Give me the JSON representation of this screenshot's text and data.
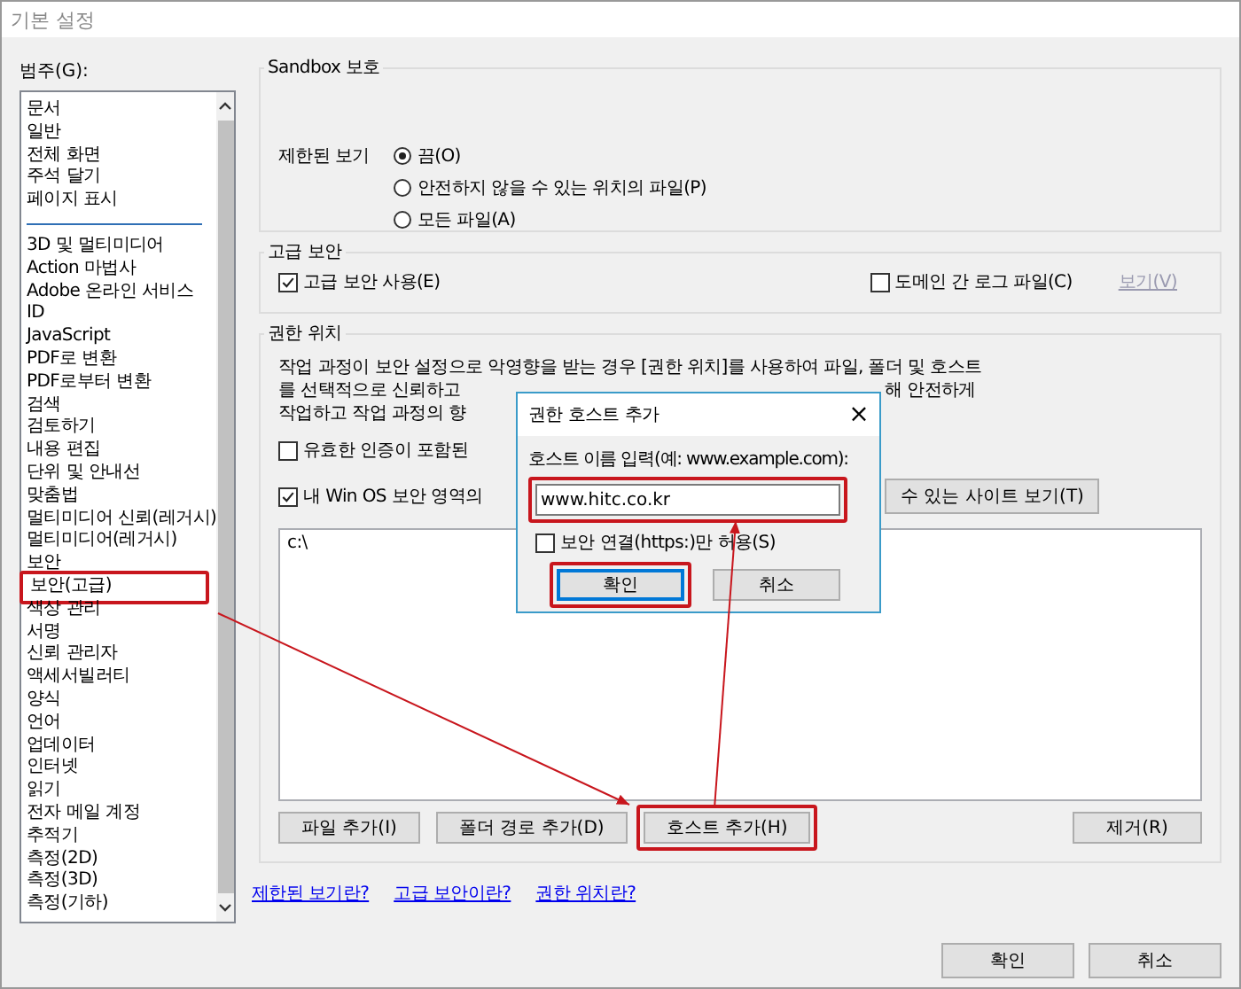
{
  "window": {
    "title": "기본 설정"
  },
  "categories": {
    "label": "범주(G):",
    "groups": [
      {
        "items": [
          {
            "label": "문서",
            "selected": false,
            "highlighted": false
          },
          {
            "label": "일반",
            "selected": false,
            "highlighted": false
          },
          {
            "label": "전체 화면",
            "selected": false,
            "highlighted": false
          },
          {
            "label": "주석 달기",
            "selected": false,
            "highlighted": false
          },
          {
            "label": "페이지 표시",
            "selected": false,
            "highlighted": false
          }
        ]
      },
      {
        "items": [
          {
            "label": "3D 및 멀티미디어",
            "selected": false,
            "highlighted": false
          },
          {
            "label": "Action 마법사",
            "selected": false,
            "highlighted": false
          },
          {
            "label": "Adobe 온라인 서비스",
            "selected": false,
            "highlighted": false
          },
          {
            "label": "ID",
            "selected": false,
            "highlighted": false
          },
          {
            "label": "JavaScript",
            "selected": false,
            "highlighted": false
          },
          {
            "label": "PDF로 변환",
            "selected": false,
            "highlighted": false
          },
          {
            "label": "PDF로부터 변환",
            "selected": false,
            "highlighted": false
          },
          {
            "label": "검색",
            "selected": false,
            "highlighted": false
          },
          {
            "label": "검토하기",
            "selected": false,
            "highlighted": false
          },
          {
            "label": "내용 편집",
            "selected": false,
            "highlighted": false
          },
          {
            "label": "단위 및 안내선",
            "selected": false,
            "highlighted": false
          },
          {
            "label": "맞춤법",
            "selected": false,
            "highlighted": false
          },
          {
            "label": "멀티미디어 신뢰(레거시)",
            "selected": false,
            "highlighted": false
          },
          {
            "label": "멀티미디어(레거시)",
            "selected": false,
            "highlighted": false
          },
          {
            "label": "보안",
            "selected": false,
            "highlighted": false
          },
          {
            "label": "보안(고급)",
            "selected": false,
            "highlighted": true
          },
          {
            "label": "색상 관리",
            "selected": false,
            "highlighted": false
          },
          {
            "label": "서명",
            "selected": false,
            "highlighted": false
          },
          {
            "label": "신뢰 관리자",
            "selected": false,
            "highlighted": false
          },
          {
            "label": "액세서빌러티",
            "selected": false,
            "highlighted": false
          },
          {
            "label": "양식",
            "selected": false,
            "highlighted": false
          },
          {
            "label": "언어",
            "selected": false,
            "highlighted": false
          },
          {
            "label": "업데이터",
            "selected": false,
            "highlighted": false
          },
          {
            "label": "인터넷",
            "selected": false,
            "highlighted": false
          },
          {
            "label": "읽기",
            "selected": false,
            "highlighted": false
          },
          {
            "label": "전자 메일 계정",
            "selected": false,
            "highlighted": false
          },
          {
            "label": "추적기",
            "selected": false,
            "highlighted": false
          },
          {
            "label": "측정(2D)",
            "selected": false,
            "highlighted": false
          },
          {
            "label": "측정(3D)",
            "selected": false,
            "highlighted": false
          },
          {
            "label": "측정(기하)",
            "selected": false,
            "highlighted": false
          }
        ]
      }
    ]
  },
  "sandbox": {
    "title": "Sandbox 보호",
    "label": "제한된 보기",
    "options": [
      {
        "label": "끔(O)",
        "selected": true
      },
      {
        "label": "안전하지 않을 수 있는 위치의 파일(P)",
        "selected": false
      },
      {
        "label": "모든 파일(A)",
        "selected": false
      }
    ]
  },
  "enhanced_security": {
    "title": "고급 보안",
    "checkboxes": [
      {
        "label": "고급 보안 사용(E)",
        "checked": true
      },
      {
        "label": "도메인 간 로그 파일(C)",
        "checked": false
      }
    ],
    "view_link": {
      "label": "보기(V)",
      "disabled": true
    }
  },
  "privileged_locations": {
    "title": "권한 위치",
    "lines": [
      {
        "left": "작업 과정이 보안 설정으로 악영향을 받는 경우 [권한 위치]를 사용하여 파일, 폴더 및 호스트"
      },
      {
        "left": "를 선택적으로 신뢰하고",
        "right": "해 안전하게"
      },
      {
        "left": "작업하고 작업 과정의 향"
      }
    ],
    "checkboxes": [
      {
        "label": "유효한 인증이 포함된",
        "checked": false
      },
      {
        "label": "내 Win OS 보안 영역의",
        "checked": true,
        "button": "수 있는 사이트 보기(T)"
      }
    ],
    "locations": [
      "c:\\"
    ],
    "buttons": [
      {
        "label": "파일 추가(I)",
        "highlighted": false
      },
      {
        "label": "폴더 경로 추가(D)",
        "highlighted": false
      },
      {
        "label": "호스트 추가(H)",
        "highlighted": true
      }
    ],
    "remove_button": "제거(R)"
  },
  "help_links": [
    "제한된 보기란?",
    "고급 보안이란?",
    "권한 위치란?"
  ],
  "buttons": [
    {
      "label": "확인"
    },
    {
      "label": "취소"
    }
  ],
  "add_host_dialog": {
    "title": "권한 호스트 추가",
    "close": "×",
    "label": "호스트 이름 입력(예: www.example.com):",
    "value": "www.hitc.co.kr",
    "value_highlighted": true,
    "https_only": {
      "label": "보안 연결(https:)만 허용(S)",
      "checked": false
    },
    "buttons": [
      {
        "label": "확인",
        "default": true,
        "highlighted": true
      },
      {
        "label": "취소",
        "default": false,
        "highlighted": false
      }
    ]
  }
}
